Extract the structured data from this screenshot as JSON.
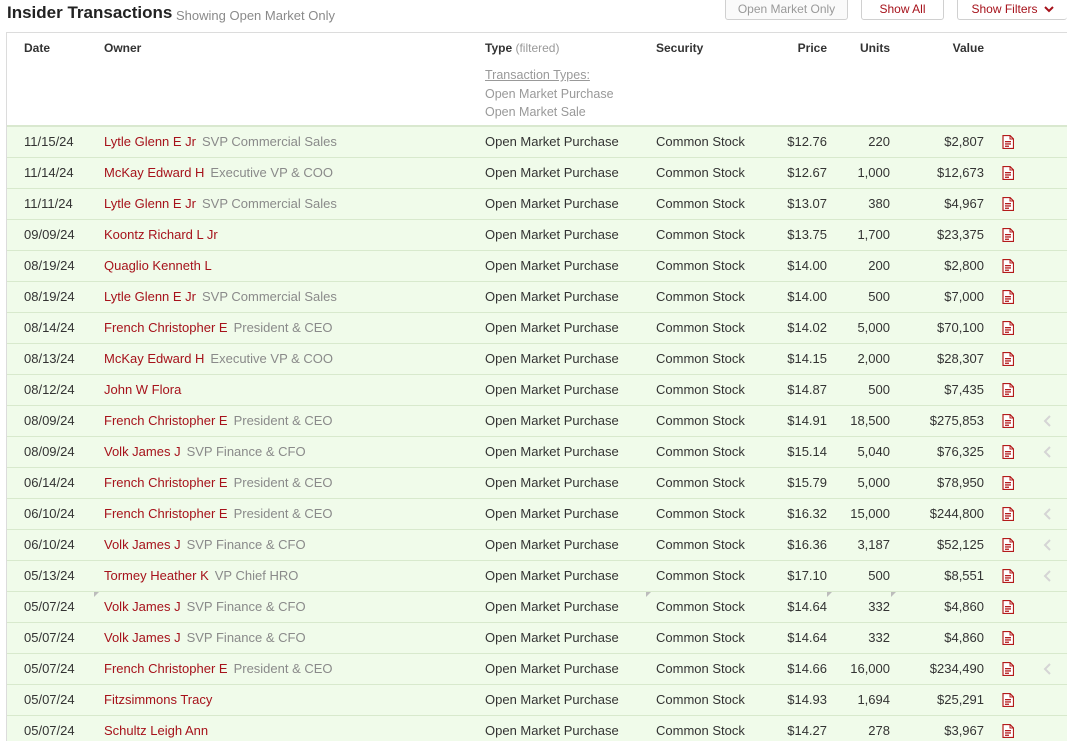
{
  "header": {
    "title": "Insider Transactions",
    "subtitle": "Showing Open Market Only",
    "buttons": {
      "open_market_only": "Open Market Only",
      "show_all": "Show All",
      "show_filters": "Show Filters"
    }
  },
  "columns": {
    "date": "Date",
    "owner": "Owner",
    "type": "Type",
    "type_note": "(filtered)",
    "security": "Security",
    "price": "Price",
    "units": "Units",
    "value": "Value"
  },
  "transaction_types": {
    "label": "Transaction Types:",
    "items": [
      "Open Market Purchase",
      "Open Market Sale"
    ]
  },
  "colors": {
    "accent": "#a6121b",
    "row_bg": "#f0fbea",
    "row_border": "#d8e9cd",
    "muted": "#8a8a8a"
  },
  "icons": {
    "document": "document-icon",
    "collapse": "chevron-left-icon",
    "dropdown": "chevron-down-icon"
  },
  "rows": [
    {
      "date": "11/15/24",
      "owner": "Lytle Glenn E Jr",
      "title": "SVP Commercial Sales",
      "type": "Open Market Purchase",
      "security": "Common Stock",
      "price": "$12.76",
      "units": "220",
      "value": "$2,807",
      "chevron": false
    },
    {
      "date": "11/14/24",
      "owner": "McKay Edward H",
      "title": "Executive VP & COO",
      "type": "Open Market Purchase",
      "security": "Common Stock",
      "price": "$12.67",
      "units": "1,000",
      "value": "$12,673",
      "chevron": false
    },
    {
      "date": "11/11/24",
      "owner": "Lytle Glenn E Jr",
      "title": "SVP Commercial Sales",
      "type": "Open Market Purchase",
      "security": "Common Stock",
      "price": "$13.07",
      "units": "380",
      "value": "$4,967",
      "chevron": false
    },
    {
      "date": "09/09/24",
      "owner": "Koontz Richard L Jr",
      "title": "",
      "type": "Open Market Purchase",
      "security": "Common Stock",
      "price": "$13.75",
      "units": "1,700",
      "value": "$23,375",
      "chevron": false
    },
    {
      "date": "08/19/24",
      "owner": "Quaglio Kenneth L",
      "title": "",
      "type": "Open Market Purchase",
      "security": "Common Stock",
      "price": "$14.00",
      "units": "200",
      "value": "$2,800",
      "chevron": false
    },
    {
      "date": "08/19/24",
      "owner": "Lytle Glenn E Jr",
      "title": "SVP Commercial Sales",
      "type": "Open Market Purchase",
      "security": "Common Stock",
      "price": "$14.00",
      "units": "500",
      "value": "$7,000",
      "chevron": false
    },
    {
      "date": "08/14/24",
      "owner": "French Christopher E",
      "title": "President & CEO",
      "type": "Open Market Purchase",
      "security": "Common Stock",
      "price": "$14.02",
      "units": "5,000",
      "value": "$70,100",
      "chevron": false
    },
    {
      "date": "08/13/24",
      "owner": "McKay Edward H",
      "title": "Executive VP & COO",
      "type": "Open Market Purchase",
      "security": "Common Stock",
      "price": "$14.15",
      "units": "2,000",
      "value": "$28,307",
      "chevron": false
    },
    {
      "date": "08/12/24",
      "owner": "John W Flora",
      "title": "",
      "type": "Open Market Purchase",
      "security": "Common Stock",
      "price": "$14.87",
      "units": "500",
      "value": "$7,435",
      "chevron": false
    },
    {
      "date": "08/09/24",
      "owner": "French Christopher E",
      "title": "President & CEO",
      "type": "Open Market Purchase",
      "security": "Common Stock",
      "price": "$14.91",
      "units": "18,500",
      "value": "$275,853",
      "chevron": true
    },
    {
      "date": "08/09/24",
      "owner": "Volk James J",
      "title": "SVP Finance & CFO",
      "type": "Open Market Purchase",
      "security": "Common Stock",
      "price": "$15.14",
      "units": "5,040",
      "value": "$76,325",
      "chevron": true
    },
    {
      "date": "06/14/24",
      "owner": "French Christopher E",
      "title": "President & CEO",
      "type": "Open Market Purchase",
      "security": "Common Stock",
      "price": "$15.79",
      "units": "5,000",
      "value": "$78,950",
      "chevron": false
    },
    {
      "date": "06/10/24",
      "owner": "French Christopher E",
      "title": "President & CEO",
      "type": "Open Market Purchase",
      "security": "Common Stock",
      "price": "$16.32",
      "units": "15,000",
      "value": "$244,800",
      "chevron": true
    },
    {
      "date": "06/10/24",
      "owner": "Volk James J",
      "title": "SVP Finance & CFO",
      "type": "Open Market Purchase",
      "security": "Common Stock",
      "price": "$16.36",
      "units": "3,187",
      "value": "$52,125",
      "chevron": true
    },
    {
      "date": "05/13/24",
      "owner": "Tormey Heather K",
      "title": "VP Chief HRO",
      "type": "Open Market Purchase",
      "security": "Common Stock",
      "price": "$17.10",
      "units": "500",
      "value": "$8,551",
      "chevron": true
    },
    {
      "date": "05/07/24",
      "owner": "Volk James J",
      "title": "SVP Finance & CFO",
      "type": "Open Market Purchase",
      "security": "Common Stock",
      "price": "$14.64",
      "units": "332",
      "value": "$4,860",
      "chevron": false
    },
    {
      "date": "05/07/24",
      "owner": "Volk James J",
      "title": "SVP Finance & CFO",
      "type": "Open Market Purchase",
      "security": "Common Stock",
      "price": "$14.64",
      "units": "332",
      "value": "$4,860",
      "chevron": false
    },
    {
      "date": "05/07/24",
      "owner": "French Christopher E",
      "title": "President & CEO",
      "type": "Open Market Purchase",
      "security": "Common Stock",
      "price": "$14.66",
      "units": "16,000",
      "value": "$234,490",
      "chevron": true
    },
    {
      "date": "05/07/24",
      "owner": "Fitzsimmons Tracy",
      "title": "",
      "type": "Open Market Purchase",
      "security": "Common Stock",
      "price": "$14.93",
      "units": "1,694",
      "value": "$25,291",
      "chevron": false
    },
    {
      "date": "05/07/24",
      "owner": "Schultz Leigh Ann",
      "title": "",
      "type": "Open Market Purchase",
      "security": "Common Stock",
      "price": "$14.27",
      "units": "278",
      "value": "$3,967",
      "chevron": false
    }
  ]
}
